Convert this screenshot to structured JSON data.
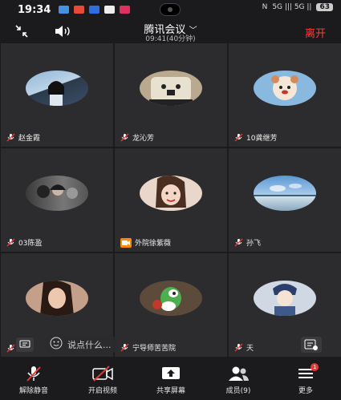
{
  "status_bar": {
    "time": "19:34",
    "network": "5G ||| 5G ||",
    "battery": "63"
  },
  "header": {
    "title": "腾讯会议",
    "subtitle": "09:41(40分钟)",
    "leave": "离开"
  },
  "participants": [
    {
      "name": "赵金霞",
      "mic": "muted",
      "avatar": "woman-field"
    },
    {
      "name": "龙沁芳",
      "mic": "muted",
      "avatar": "dog-toy"
    },
    {
      "name": "10龚继芳",
      "mic": "muted",
      "avatar": "bear-cartoon"
    },
    {
      "name": "03陈盈",
      "mic": "muted",
      "avatar": "crowd-dark"
    },
    {
      "name": "外院徐紫薇",
      "mic": "camera",
      "avatar": "girl-smile"
    },
    {
      "name": "孙飞",
      "mic": "muted",
      "avatar": "sky-sea"
    },
    {
      "name": "",
      "mic": "muted",
      "avatar": "portrait"
    },
    {
      "name": "宁导师苦苦院",
      "mic": "muted",
      "avatar": "yoshi-toy"
    },
    {
      "name": "天",
      "mic": "muted",
      "avatar": "painted-girl"
    }
  ],
  "chat": {
    "placeholder": "说点什么..."
  },
  "toolbar": {
    "unmute": "解除静音",
    "video": "开启视频",
    "share": "共享屏幕",
    "members": "成员(9)",
    "more": "更多",
    "more_badge": "1"
  },
  "colors": {
    "leave": "#ee4444",
    "cam_badge": "#ff8a00",
    "tile_bg": "#2c2c2e"
  }
}
